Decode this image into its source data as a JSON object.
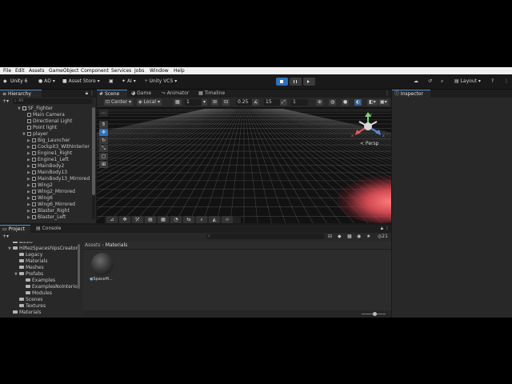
{
  "menu": [
    "File",
    "Edit",
    "Assets",
    "GameObject",
    "Component",
    "Services",
    "Jobs",
    "Window",
    "Help"
  ],
  "toolbar": {
    "unity_label": "Unity 6",
    "account_label": "AD",
    "asset_store_label": "Asset Store",
    "ai_label": "AI",
    "vcs_label": "Unity VCS",
    "layout_label": "Layout"
  },
  "hierarchy": {
    "tab_label": "Hierarchy",
    "search_placeholder": "All",
    "add_label": "+",
    "root": "SF_Fighter",
    "items": [
      {
        "label": "Main Camera"
      },
      {
        "label": "Directional Light"
      },
      {
        "label": "Point light"
      },
      {
        "label": "player"
      },
      {
        "label": "Big_Launcher"
      },
      {
        "label": "Cockpit3_WithInterior"
      },
      {
        "label": "Engine1_Right"
      },
      {
        "label": "Engine1_Left"
      },
      {
        "label": "MainBody2"
      },
      {
        "label": "MainBody13"
      },
      {
        "label": "MainBody13_Mirrored"
      },
      {
        "label": "Wing2"
      },
      {
        "label": "Wing2_Mirrored"
      },
      {
        "label": "Wing6"
      },
      {
        "label": "Wing6_Mirrored"
      },
      {
        "label": "Blaster_Right"
      },
      {
        "label": "Blaster_Left"
      }
    ]
  },
  "scene": {
    "tabs": [
      "Scene",
      "Game",
      "Animator",
      "Timeline"
    ],
    "pivot_label": "Center",
    "space_label": "Local",
    "grid_value": "1",
    "snap_value": "0.25",
    "angle_value": "15",
    "scale_value": "1",
    "persp_label": "< Persp",
    "axis_y": "y",
    "axis_x": "x",
    "axis_z": "z"
  },
  "project": {
    "tabs": [
      "Project",
      "Console"
    ],
    "add_label": "+",
    "search_placeholder": "",
    "count_label": "21",
    "breadcrumb_root": "Assets",
    "breadcrumb_current": "Materials",
    "folders": [
      {
        "label": "audio",
        "indent": 0
      },
      {
        "label": "HiRezSpaceshipsCreatorFree",
        "indent": 0
      },
      {
        "label": "Legacy",
        "indent": 1
      },
      {
        "label": "Materials",
        "indent": 1
      },
      {
        "label": "Meshes",
        "indent": 1
      },
      {
        "label": "Prefabs",
        "indent": 1
      },
      {
        "label": "Examples",
        "indent": 2
      },
      {
        "label": "ExamplesNoInterior",
        "indent": 2
      },
      {
        "label": "Modules",
        "indent": 2
      },
      {
        "label": "Scenes",
        "indent": 1
      },
      {
        "label": "Textures",
        "indent": 1
      },
      {
        "label": "Materials",
        "indent": 0
      }
    ],
    "asset_name": "SpaceM..."
  },
  "inspector": {
    "tab_label": "Inspector"
  },
  "colors": {
    "accent": "#4a90d9",
    "menubar": "#f0f0f0",
    "panel": "#282828",
    "scene_bg": "#121212"
  }
}
